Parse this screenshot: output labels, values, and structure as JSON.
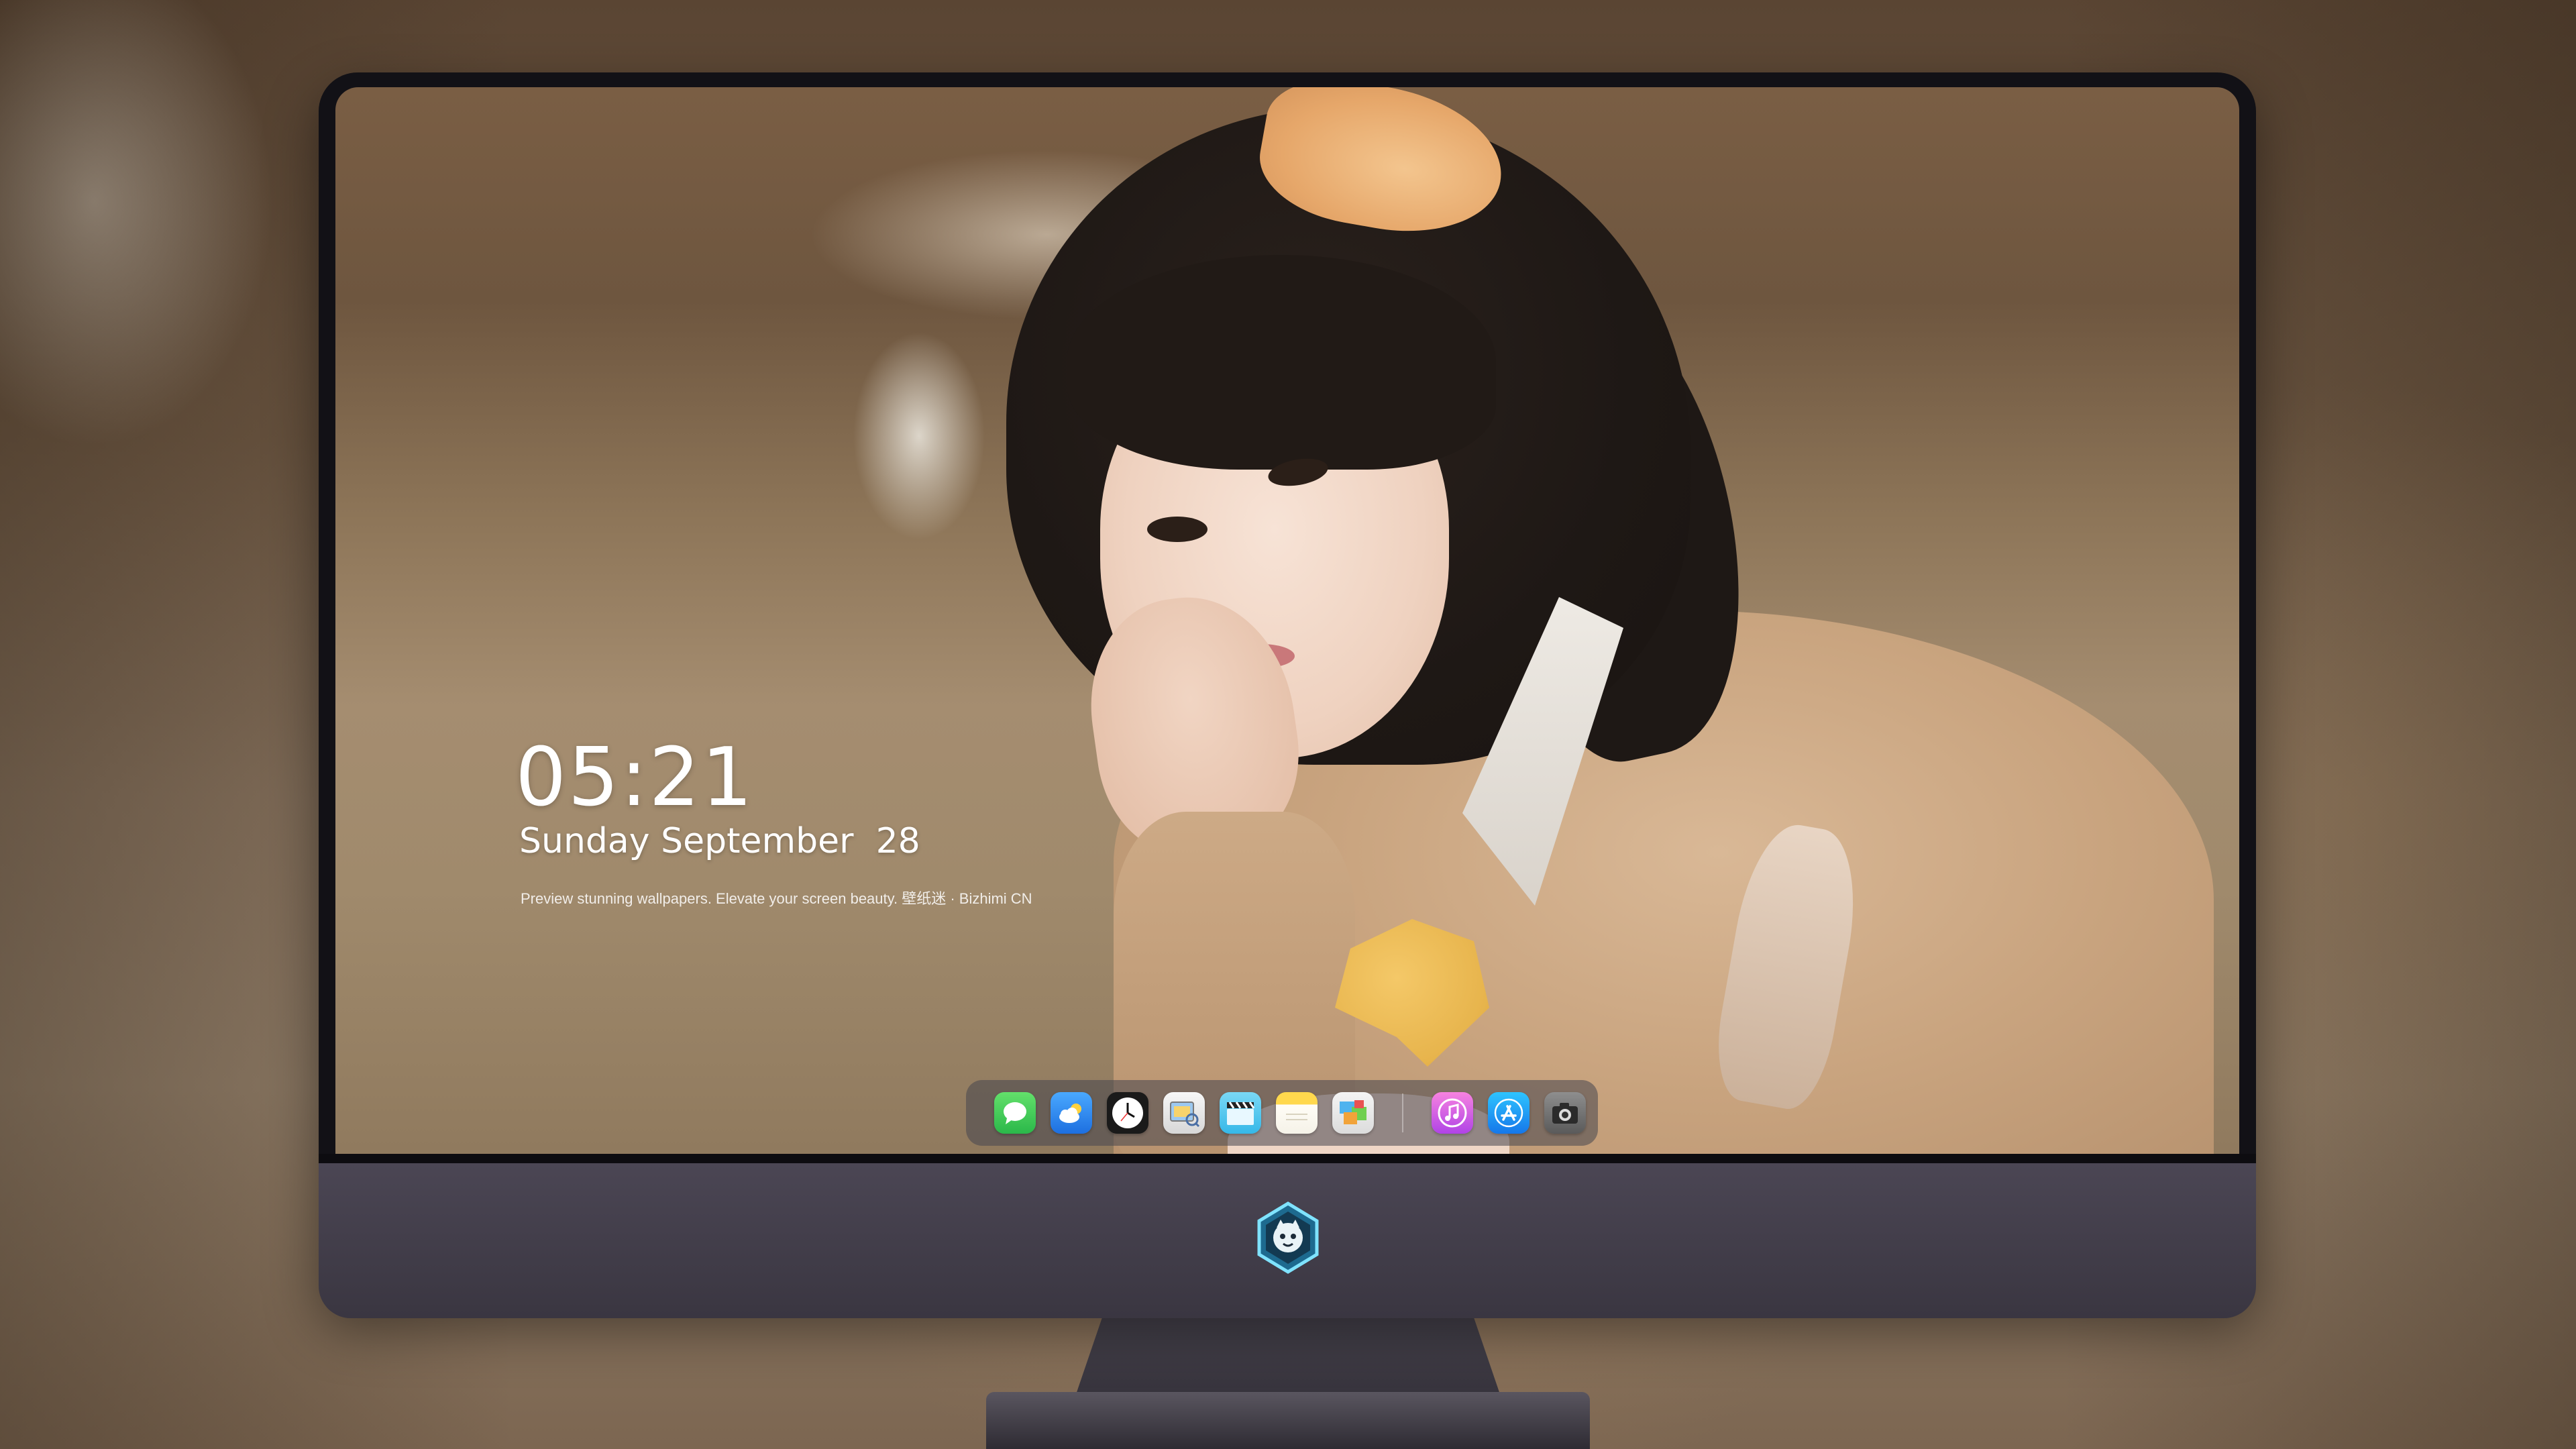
{
  "lock_screen": {
    "time": "05:21",
    "date": "Sunday September  28",
    "tagline": "Preview stunning wallpapers. Elevate your screen beauty. 壁纸迷 · Bizhimi CN"
  },
  "dock": {
    "apps": [
      {
        "name": "messages",
        "icon": "message-bubble"
      },
      {
        "name": "weather",
        "icon": "cloud-sun"
      },
      {
        "name": "clock",
        "icon": "clock"
      },
      {
        "name": "preview",
        "icon": "photo-viewer"
      },
      {
        "name": "clapperboard",
        "icon": "clapperboard"
      },
      {
        "name": "notes",
        "icon": "notepad"
      },
      {
        "name": "photos",
        "icon": "photo-collage"
      }
    ],
    "right_apps": [
      {
        "name": "itunes",
        "icon": "music-note"
      },
      {
        "name": "app-store",
        "icon": "app-store-a"
      },
      {
        "name": "camera",
        "icon": "camera"
      }
    ]
  },
  "colors": {
    "bezel": "#121116",
    "chin": "#4b4654",
    "dock_bg": "rgba(70,70,78,0.55)",
    "text": "#ffffff"
  }
}
